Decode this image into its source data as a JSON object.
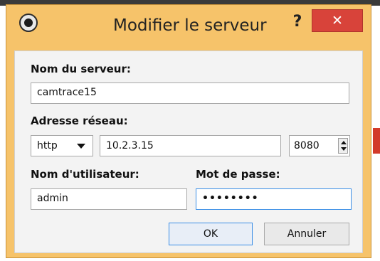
{
  "window": {
    "title": "Modifier le serveur",
    "help_label": "?",
    "close_label": "✕",
    "app_icon": "camtrace-eye-icon"
  },
  "form": {
    "server_name_label": "Nom du serveur:",
    "server_name_value": "camtrace15",
    "network_address_label": "Adresse réseau:",
    "protocol_value": "http",
    "protocol_icon": "chevron-down-icon",
    "address_value": "10.2.3.15",
    "port_value": "8080",
    "username_label": "Nom d'utilisateur:",
    "username_value": "admin",
    "password_label": "Mot de passe:",
    "password_value": "••••••••"
  },
  "buttons": {
    "ok_label": "OK",
    "cancel_label": "Annuler"
  },
  "colors": {
    "titlebar": "#f6c36a",
    "close_button": "#d8433a",
    "focus_border": "#3a8ee6"
  }
}
